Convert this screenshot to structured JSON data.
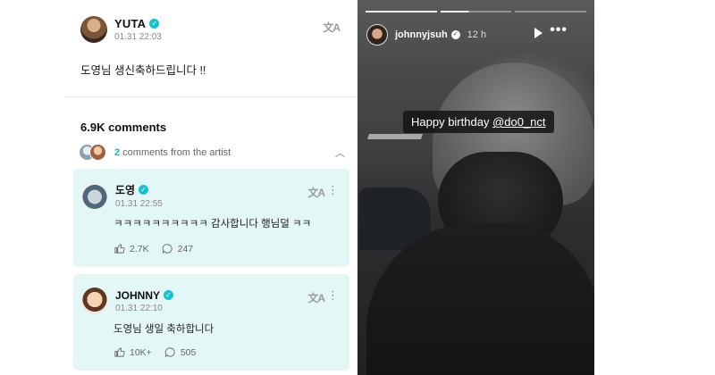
{
  "post": {
    "author": "YUTA",
    "date": "01.31 22:03",
    "body": "도영님 생신축하드립니다 !!",
    "translate_icon": "translate-icon"
  },
  "comments_section": {
    "count_label": "6.9K comments",
    "artist_count": "2",
    "artist_label": " comments from the artist"
  },
  "comments": [
    {
      "author": "도영",
      "date": "01.31 22:55",
      "text": "ㅋㅋㅋㅋㅋㅋㅋㅋㅋㅋ 감사합니다 행님덜 ㅋㅋ",
      "likes": "2.7K",
      "replies": "247"
    },
    {
      "author": "JOHNNY",
      "date": "01.31 22:10",
      "text": "도영님 생일 축하합니다",
      "likes": "10K+",
      "replies": "505"
    }
  ],
  "story": {
    "username": "johnnyjsuh",
    "time": "12 h",
    "caption_prefix": "Happy birthday ",
    "caption_mention": "@do0_nct",
    "progress": [
      1,
      0.4,
      0
    ]
  },
  "icons": {
    "verified": "✓",
    "translate": "文A",
    "more": "⋮",
    "chevron": "︿",
    "story_more": "•••"
  }
}
